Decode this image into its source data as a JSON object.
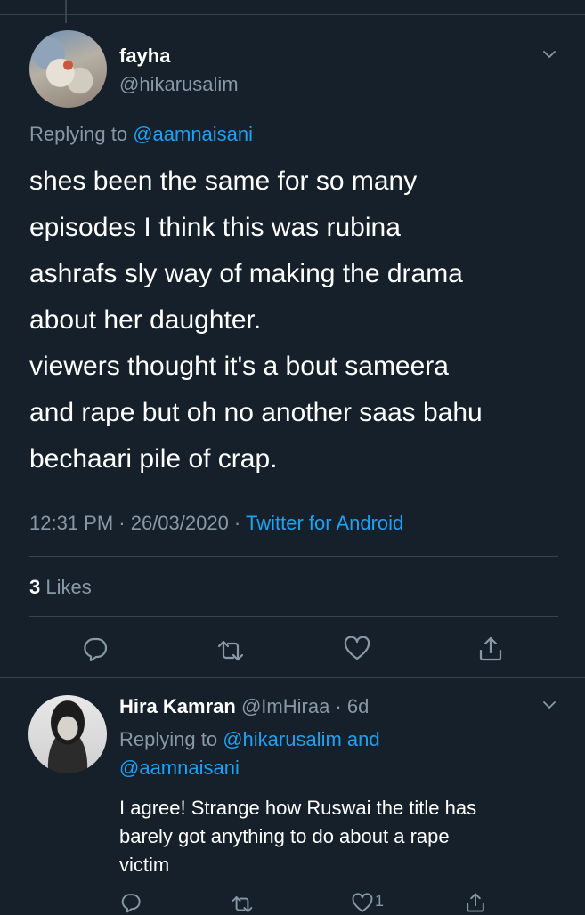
{
  "colors": {
    "background": "#15202b",
    "text_primary": "#ffffff",
    "text_secondary": "#8899a6",
    "link": "#1da1f2",
    "divider": "#38444d"
  },
  "main_tweet": {
    "display_name": "fayha",
    "handle": "@hikarusalim",
    "replying_prefix": "Replying to ",
    "replying_to": "@aamnaisani",
    "text_lines": [
      "shes been the same for so many",
      "episodes I think this was rubina",
      "ashrafs sly way of making the drama",
      "about her daughter.",
      "viewers thought it's a bout sameera",
      "and rape but oh no another saas bahu",
      "bechaari pile of crap."
    ],
    "time": "12:31 PM · 26/03/2020 · ",
    "source": "Twitter for Android",
    "likes_count": "3",
    "likes_label": " Likes",
    "icons": [
      "chevron-down-icon",
      "reply-icon",
      "retweet-icon",
      "like-icon",
      "share-icon"
    ]
  },
  "reply_tweet": {
    "display_name": "Hira Kamran",
    "handle_time": " @ImHiraa · 6d",
    "replying_prefix": "Replying to ",
    "replying_to_1": "@hikarusalim",
    "replying_and": " and",
    "replying_to_2": "@aamnaisani",
    "text_lines": [
      "I agree! Strange how Ruswai the title has",
      "barely got anything to do about a rape",
      "victim"
    ],
    "like_count": "1",
    "icons": [
      "chevron-down-icon",
      "reply-icon",
      "retweet-icon",
      "like-icon",
      "share-icon"
    ]
  }
}
